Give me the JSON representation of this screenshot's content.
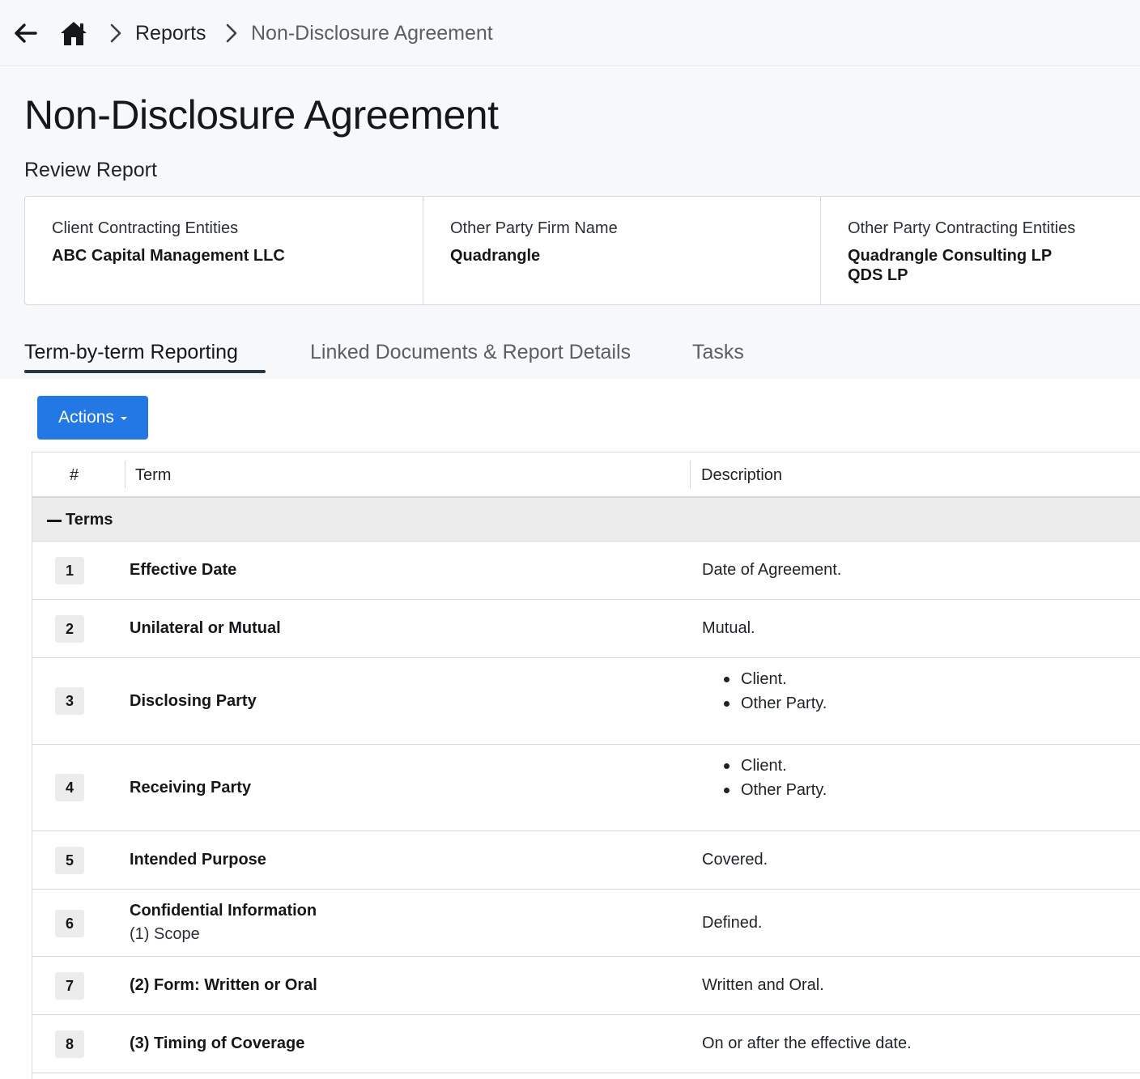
{
  "breadcrumb": {
    "items": [
      {
        "label": "Reports"
      },
      {
        "label": "Non-Disclosure Agreement"
      }
    ]
  },
  "page": {
    "title": "Non-Disclosure Agreement",
    "subtitle": "Review Report"
  },
  "info": [
    {
      "label": "Client Contracting Entities",
      "values": [
        "ABC Capital Management LLC"
      ]
    },
    {
      "label": "Other Party Firm Name",
      "values": [
        "Quadrangle"
      ]
    },
    {
      "label": "Other Party Contracting Entities",
      "values": [
        "Quadrangle Consulting LP",
        "QDS LP"
      ]
    }
  ],
  "tabs": [
    {
      "label": "Term-by-term Reporting",
      "active": true
    },
    {
      "label": "Linked Documents & Report Details",
      "active": false
    },
    {
      "label": "Tasks",
      "active": false
    }
  ],
  "actions": {
    "label": "Actions"
  },
  "table": {
    "headers": {
      "num": "#",
      "term": "Term",
      "description": "Description"
    },
    "group": "Terms",
    "rows": [
      {
        "num": "1",
        "term": "Effective Date",
        "description": "Date of Agreement."
      },
      {
        "num": "2",
        "term": "Unilateral or Mutual",
        "description": "Mutual."
      },
      {
        "num": "3",
        "term": "Disclosing Party",
        "bullets": [
          "Client.",
          "Other Party."
        ]
      },
      {
        "num": "4",
        "term": "Receiving Party",
        "bullets": [
          "Client.",
          "Other Party."
        ]
      },
      {
        "num": "5",
        "term": "Intended Purpose",
        "description": "Covered."
      },
      {
        "num": "6",
        "term": "Confidential Information",
        "term_sub": "(1) Scope",
        "description": "Defined."
      },
      {
        "num": "7",
        "term": "(2) Form: Written or Oral",
        "description": "Written and Oral."
      },
      {
        "num": "8",
        "term": "(3) Timing of Coverage",
        "description": "On or after the effective date."
      }
    ]
  },
  "colors": {
    "accent": "#2378e5",
    "header_bg": "#f7f8fa",
    "group_bg": "#ececec"
  }
}
